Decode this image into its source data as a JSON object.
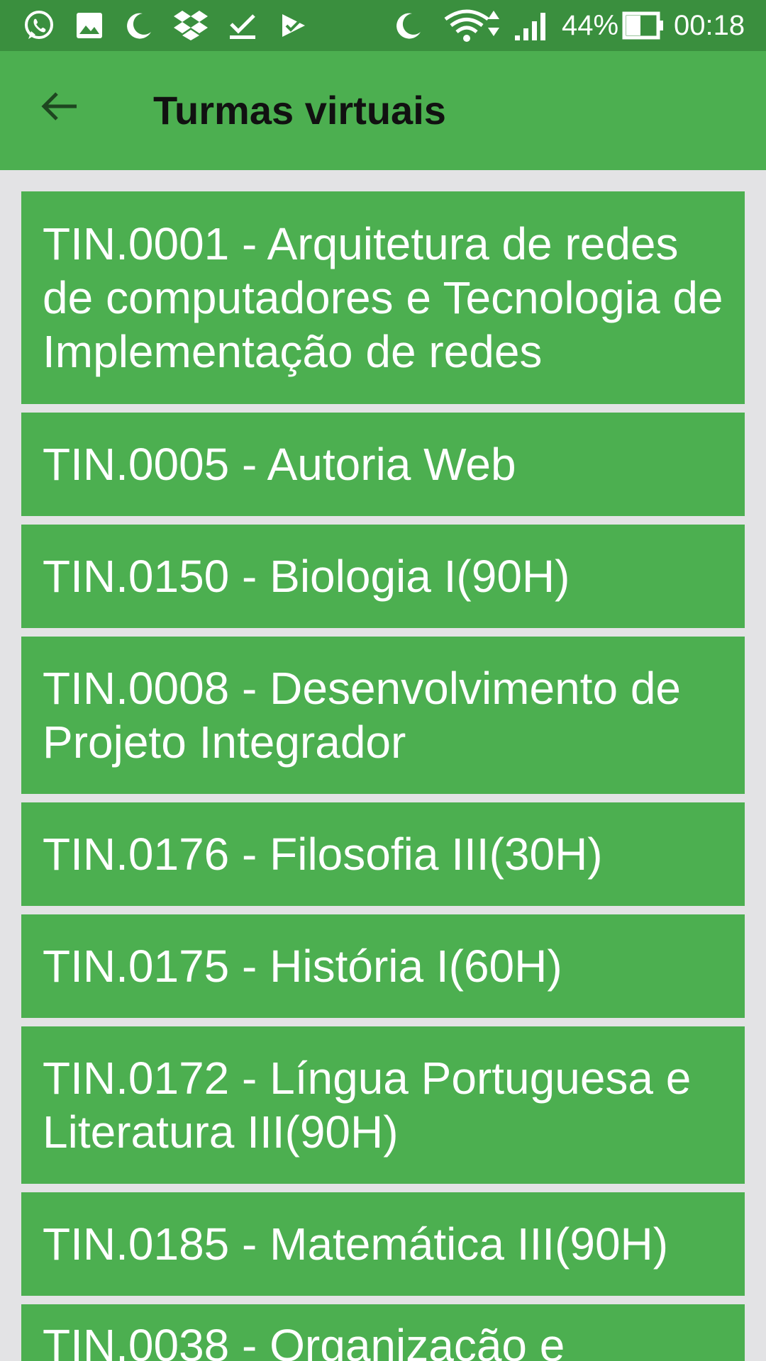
{
  "status_bar": {
    "battery_percent": "44%",
    "time": "00:18",
    "icons": [
      "whatsapp-icon",
      "image-icon",
      "moon-icon",
      "dropbox-icon",
      "download-done-icon",
      "task-icon",
      "moon-icon",
      "wifi-icon",
      "signal-icon",
      "battery-icon"
    ]
  },
  "app_bar": {
    "title": "Turmas virtuais",
    "back_icon": "arrow-back-icon"
  },
  "colors": {
    "status_bar": "#3a8f3e",
    "app_bar": "#4caf50",
    "item_background": "#4caf50",
    "page_background": "#e3e3e5"
  },
  "classes": [
    {
      "label": "TIN.0001 - Arquitetura de redes de computadores e Tecnologia de Implementação de redes"
    },
    {
      "label": "TIN.0005 - Autoria Web"
    },
    {
      "label": "TIN.0150 - Biologia I(90H)"
    },
    {
      "label": "TIN.0008 - Desenvolvimento de Projeto Integrador"
    },
    {
      "label": "TIN.0176 - Filosofia III(30H)"
    },
    {
      "label": "TIN.0175 - História I(60H)"
    },
    {
      "label": "TIN.0172 - Língua Portuguesa e Literatura III(90H)"
    },
    {
      "label": "TIN.0185 - Matemática III(90H)"
    },
    {
      "label": "TIN.0038 - Organização e"
    }
  ]
}
